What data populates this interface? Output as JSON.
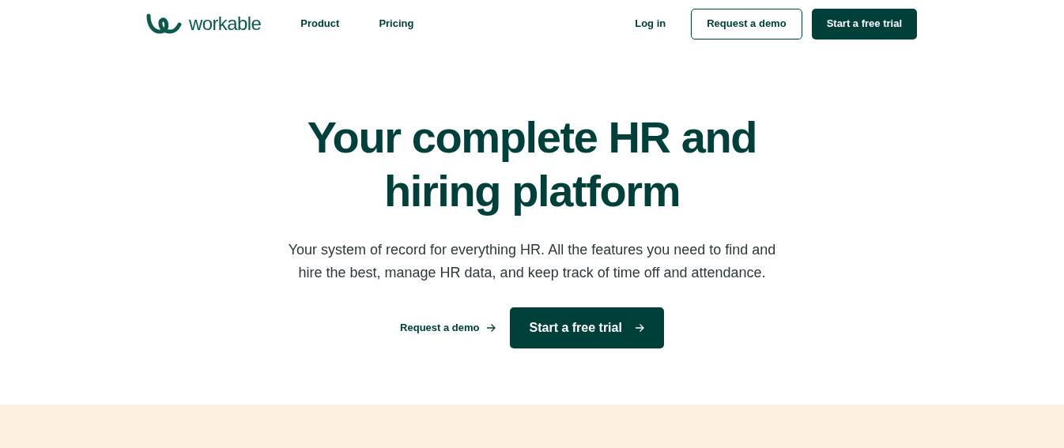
{
  "header": {
    "logo": "workable",
    "nav": [
      "Product",
      "Pricing"
    ],
    "login": "Log in",
    "demo_button": "Request a demo",
    "trial_button": "Start a free trial"
  },
  "hero": {
    "title": "Your complete HR and hiring platform",
    "subtitle": "Your system of record for everything HR. All the features you need to find and hire the best, manage HR data, and keep track of time off and attendance.",
    "demo_link": "Request a demo",
    "trial_button": "Start a free trial"
  }
}
